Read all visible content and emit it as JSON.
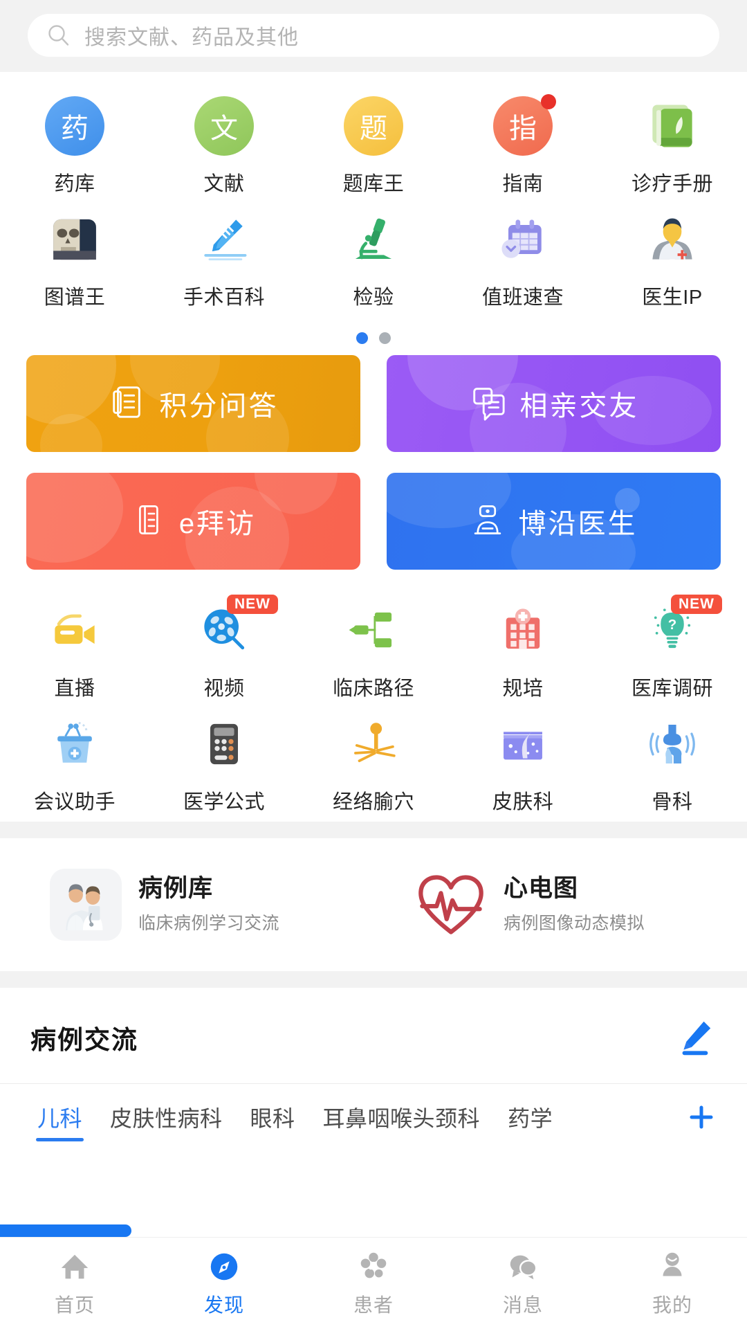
{
  "search": {
    "placeholder": "搜索文献、药品及其他",
    "icon": "search-icon"
  },
  "quick_grid": {
    "page_dots": {
      "total": 2,
      "active_index": 0
    },
    "rows": [
      [
        {
          "label": "药库",
          "icon": "circle-letter-icon",
          "glyph": "药",
          "color": "#4e9bf0",
          "badge": null
        },
        {
          "label": "文献",
          "icon": "circle-letter-icon",
          "glyph": "文",
          "color": "#9dce64",
          "badge": null
        },
        {
          "label": "题库王",
          "icon": "circle-letter-icon",
          "glyph": "题",
          "color": "#f8c950",
          "badge": null
        },
        {
          "label": "指南",
          "icon": "circle-letter-icon",
          "glyph": "指",
          "color": "#f47a5d",
          "badge": "dot"
        },
        {
          "label": "诊疗手册",
          "icon": "green-book-icon",
          "glyph": "",
          "color": "#7dbf4a",
          "badge": null
        }
      ],
      [
        {
          "label": "图谱王",
          "icon": "skull-atlas-icon",
          "glyph": "",
          "color": "#233247",
          "badge": null
        },
        {
          "label": "手术百科",
          "icon": "scalpel-icon",
          "glyph": "",
          "color": "#2e9bea",
          "badge": null
        },
        {
          "label": "检验",
          "icon": "microscope-icon",
          "glyph": "",
          "color": "#35b06b",
          "badge": null
        },
        {
          "label": "值班速查",
          "icon": "calendar-clock-icon",
          "glyph": "",
          "color": "#8f8ce8",
          "badge": null
        },
        {
          "label": "医生IP",
          "icon": "doctor-avatar-icon",
          "glyph": "",
          "color": "#f5c543",
          "badge": null
        }
      ]
    ]
  },
  "banners": [
    {
      "label": "积分问答",
      "icon": "document-list-icon",
      "theme": "b-orange"
    },
    {
      "label": "相亲交友",
      "icon": "chat-card-icon",
      "theme": "b-purple"
    },
    {
      "label": "e拜访",
      "icon": "visit-book-icon",
      "theme": "b-red"
    },
    {
      "label": "博沿医生",
      "icon": "doctor-badge-icon",
      "theme": "b-blue"
    }
  ],
  "tools_grid": {
    "rows": [
      [
        {
          "label": "直播",
          "icon": "video-camera-icon",
          "color": "#f5c93c",
          "badge": null
        },
        {
          "label": "视频",
          "icon": "film-reel-icon",
          "color": "#1f8fe0",
          "badge": "NEW"
        },
        {
          "label": "临床路径",
          "icon": "flowchart-icon",
          "color": "#7dc24b",
          "badge": null
        },
        {
          "label": "规培",
          "icon": "hospital-icon",
          "color": "#ef6f6a",
          "badge": null
        },
        {
          "label": "医库调研",
          "icon": "lightbulb-question-icon",
          "color": "#43bfa4",
          "badge": "NEW"
        }
      ],
      [
        {
          "label": "会议助手",
          "icon": "podium-icon",
          "color": "#76b8ef",
          "badge": null
        },
        {
          "label": "医学公式",
          "icon": "calculator-icon",
          "color": "#4a4a4a",
          "badge": null
        },
        {
          "label": "经络腧穴",
          "icon": "acupoint-icon",
          "color": "#f0ab2c",
          "badge": null
        },
        {
          "label": "皮肤科",
          "icon": "skin-layer-icon",
          "color": "#8b8bf0",
          "badge": null
        },
        {
          "label": "骨科",
          "icon": "joint-bone-icon",
          "color": "#4a90e2",
          "badge": null
        }
      ]
    ]
  },
  "features": [
    {
      "title": "病例库",
      "subtitle": "临床病例学习交流",
      "icon": "two-doctors-icon"
    },
    {
      "title": "心电图",
      "subtitle": "病例图像动态模拟",
      "icon": "ecg-heart-icon"
    }
  ],
  "exchange": {
    "title": "病例交流",
    "compose_icon": "pencil-icon",
    "add_icon": "plus-icon",
    "tabs": [
      {
        "label": "儿科",
        "active": true
      },
      {
        "label": "皮肤性病科",
        "active": false
      },
      {
        "label": "眼科",
        "active": false
      },
      {
        "label": "耳鼻咽喉头颈科",
        "active": false
      },
      {
        "label": "药学",
        "active": false
      }
    ]
  },
  "tabbar": [
    {
      "label": "首页",
      "icon": "home-icon",
      "active": false
    },
    {
      "label": "发现",
      "icon": "compass-icon",
      "active": true
    },
    {
      "label": "患者",
      "icon": "patients-icon",
      "active": false
    },
    {
      "label": "消息",
      "icon": "message-icon",
      "active": false
    },
    {
      "label": "我的",
      "icon": "profile-icon",
      "active": false
    }
  ],
  "colors": {
    "accent": "#1877f2",
    "tab_accent": "#2b7cf0",
    "badge_red": "#e8312a",
    "new_badge": "#f4503c",
    "page_bg": "#f2f2f2"
  }
}
